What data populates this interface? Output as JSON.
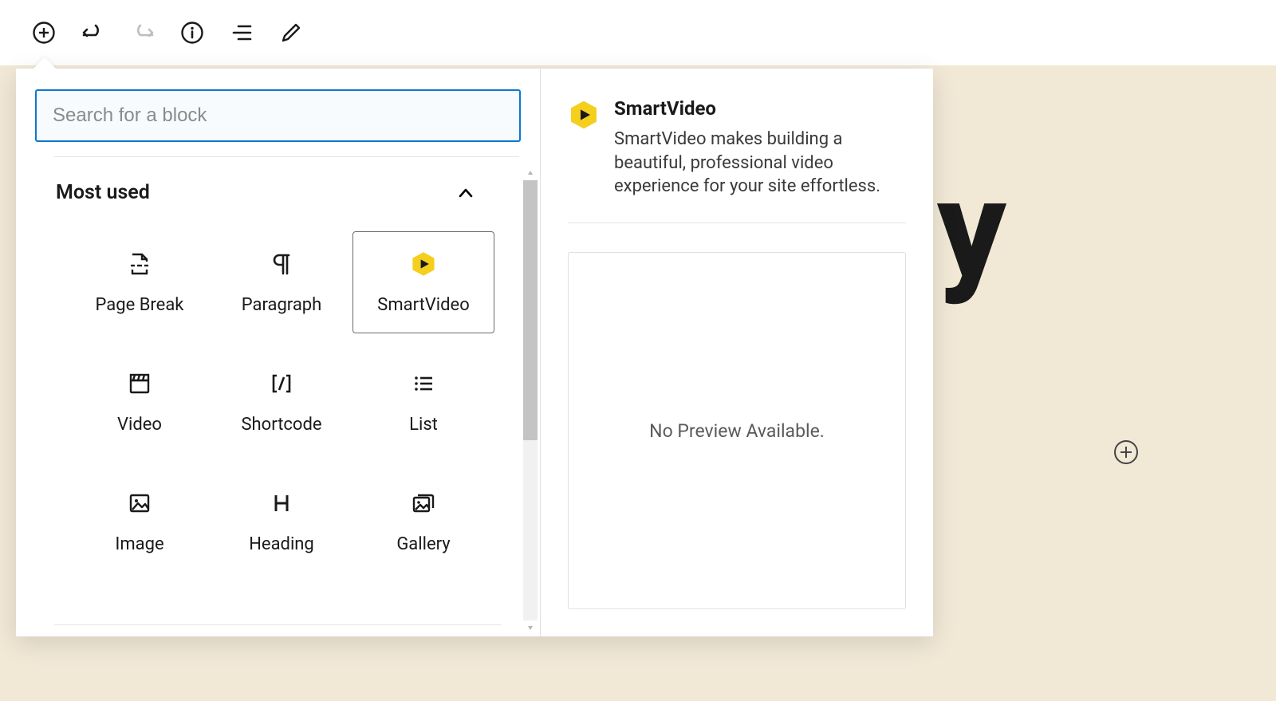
{
  "toolbar": {
    "add_label": "Add block",
    "undo_label": "Undo",
    "redo_label": "Redo",
    "info_label": "Content structure",
    "outline_label": "Block navigation",
    "edit_label": "Edit"
  },
  "canvas": {
    "title_stub": "y"
  },
  "inserter": {
    "search_placeholder": "Search for a block",
    "search_value": "",
    "section_title": "Most used",
    "blocks": [
      {
        "id": "page-break",
        "label": "Page Break",
        "icon": "page-break-icon",
        "selected": false
      },
      {
        "id": "paragraph",
        "label": "Paragraph",
        "icon": "pilcrow-icon",
        "selected": false
      },
      {
        "id": "smartvideo",
        "label": "SmartVideo",
        "icon": "smartvideo-icon",
        "selected": true
      },
      {
        "id": "video",
        "label": "Video",
        "icon": "clapper-icon",
        "selected": false
      },
      {
        "id": "shortcode",
        "label": "Shortcode",
        "icon": "shortcode-icon",
        "selected": false
      },
      {
        "id": "list",
        "label": "List",
        "icon": "list-icon",
        "selected": false
      },
      {
        "id": "image",
        "label": "Image",
        "icon": "image-icon",
        "selected": false
      },
      {
        "id": "heading",
        "label": "Heading",
        "icon": "heading-icon",
        "selected": false
      },
      {
        "id": "gallery",
        "label": "Gallery",
        "icon": "gallery-icon",
        "selected": false
      }
    ]
  },
  "preview": {
    "title": "SmartVideo",
    "description": "SmartVideo makes building a beautiful, professional video experience for your site effortless.",
    "empty_text": "No Preview Available."
  },
  "colors": {
    "accent": "#0b78cf",
    "brand_yellow": "#f5cf1e",
    "canvas_bg": "#f1e8d6"
  }
}
